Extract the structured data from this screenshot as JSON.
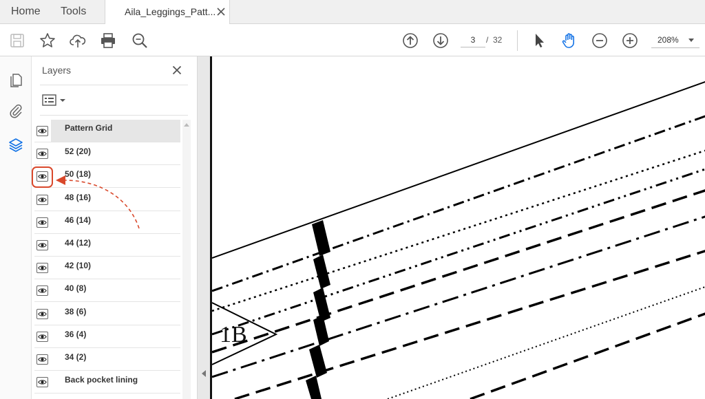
{
  "tabs": {
    "home": "Home",
    "tools": "Tools",
    "document": "Aila_Leggings_Patt..."
  },
  "toolbar": {
    "page_current": "3",
    "page_separator": "/",
    "page_total": "32",
    "zoom": "208%"
  },
  "layers_panel": {
    "title": "Layers",
    "items": [
      {
        "label": "Pattern Grid",
        "visible": true,
        "selected": true
      },
      {
        "label": "52 (20)",
        "visible": true
      },
      {
        "label": "50 (18)",
        "visible": true,
        "highlighted": true
      },
      {
        "label": "48 (16)",
        "visible": true
      },
      {
        "label": "46 (14)",
        "visible": true
      },
      {
        "label": "44 (12)",
        "visible": true
      },
      {
        "label": "42 (10)",
        "visible": true
      },
      {
        "label": "40 (8)",
        "visible": true
      },
      {
        "label": "38 (6)",
        "visible": true
      },
      {
        "label": "36 (4)",
        "visible": true
      },
      {
        "label": "34 (2)",
        "visible": true
      },
      {
        "label": "Back pocket lining",
        "visible": true
      }
    ]
  },
  "document": {
    "piece_label": "1B"
  },
  "colors": {
    "accent_blue": "#1473e6",
    "annotation_red": "#d9482b",
    "icon_gray": "#6e6e6e"
  },
  "icons": {
    "save": "save-icon",
    "bookmark": "star-icon",
    "upload": "cloud-upload-icon",
    "print": "printer-icon",
    "search": "zoom-search-icon",
    "prev_page": "arrow-up-circle-icon",
    "next_page": "arrow-down-circle-icon",
    "select": "cursor-arrow-icon",
    "hand": "hand-icon",
    "zoom_out": "minus-circle-icon",
    "zoom_in": "plus-circle-icon"
  }
}
